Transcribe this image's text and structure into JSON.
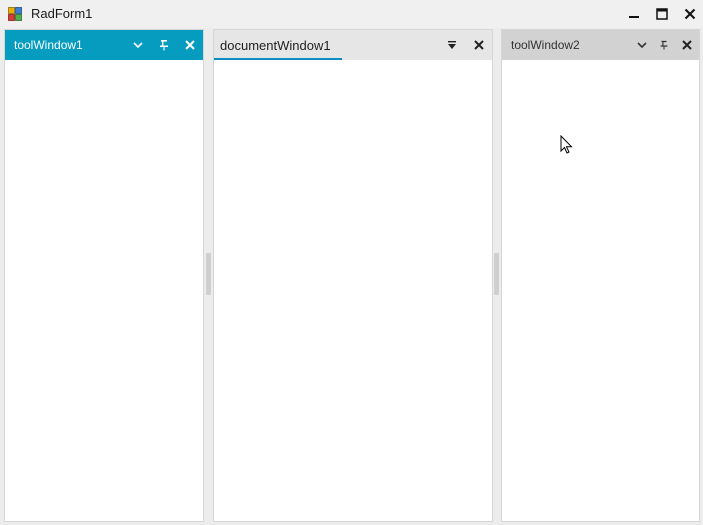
{
  "window": {
    "title": "RadForm1"
  },
  "toolWindow1": {
    "caption": "toolWindow1"
  },
  "documentWindow1": {
    "tab_label": "documentWindow1"
  },
  "toolWindow2": {
    "caption": "toolWindow2"
  },
  "colors": {
    "active_header": "#069cc0",
    "inactive_header": "#d2d2d2",
    "document_strip": "#e6e6e6",
    "tab_underline": "#0a8fc0"
  },
  "icons": {
    "app": "app-icon",
    "minimize": "minimize-icon",
    "maximize": "maximize-icon",
    "close": "close-icon",
    "dropdown": "chevron-down-icon",
    "pin": "pin-icon",
    "document_dropdown": "triangle-down-icon"
  }
}
